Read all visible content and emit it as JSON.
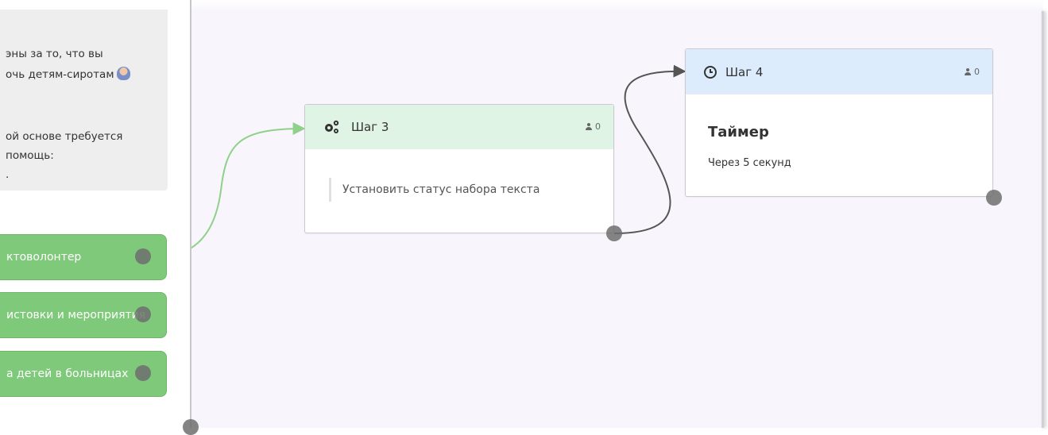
{
  "left_panel": {
    "message_lines": [
      "эны за то, что вы",
      "очь детям-сиротам",
      "ой основе требуется",
      "помощь:",
      "."
    ],
    "buttons": [
      {
        "label": "ктоволонтер"
      },
      {
        "label": "истовки и мероприятия"
      },
      {
        "label": "а детей в больницах"
      }
    ]
  },
  "nodes": {
    "step3": {
      "title": "Шаг 3",
      "count": "0",
      "action": "Установить статус набора текста",
      "header_color": "#e0f4e6",
      "icon": "gears-icon"
    },
    "step4": {
      "title": "Шаг 4",
      "count": "0",
      "body_title": "Таймер",
      "body_sub": "Через 5 секунд",
      "header_color": "#dcecfc",
      "icon": "clock-icon"
    }
  },
  "colors": {
    "button_green": "#7fc97a",
    "wire_green": "#8fd08a",
    "wire_dark": "#555555"
  }
}
